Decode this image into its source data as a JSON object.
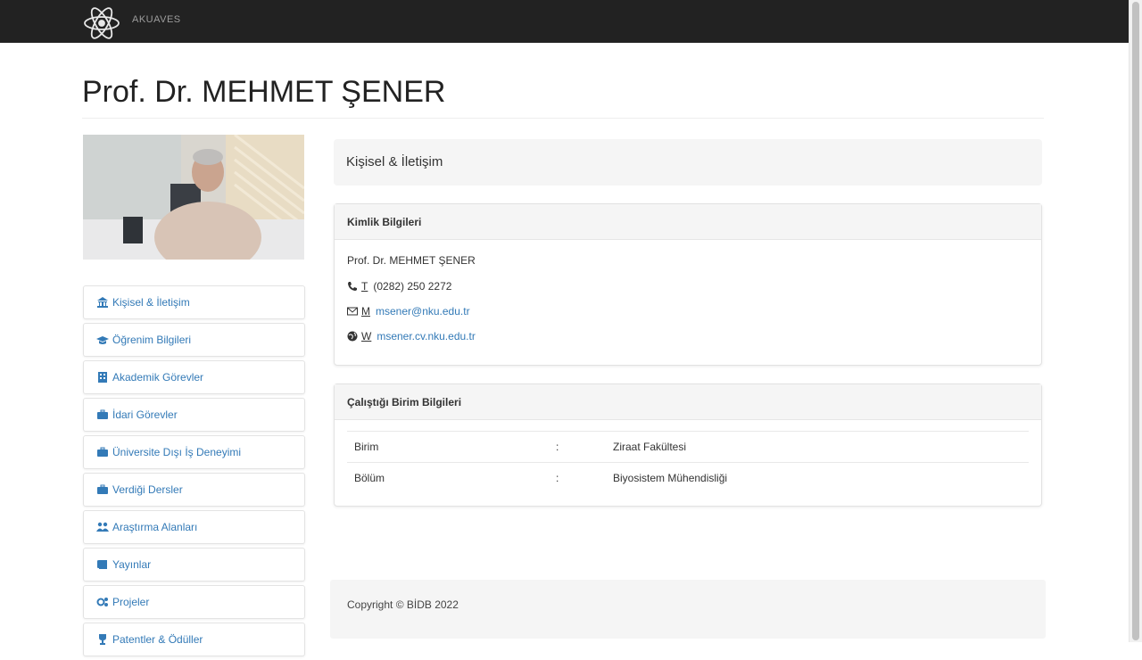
{
  "navbar": {
    "brand": "AKUAVES",
    "logo_icon": "atom-logo-icon",
    "background": "#222222"
  },
  "profile": {
    "name": "Prof. Dr. MEHMET ŞENER"
  },
  "sidebar": {
    "items": [
      {
        "label": "Kişisel & İletişim",
        "icon": "bank-icon"
      },
      {
        "label": "Öğrenim Bilgileri",
        "icon": "graduation-cap-icon"
      },
      {
        "label": "Akademik Görevler",
        "icon": "building-icon"
      },
      {
        "label": "İdari Görevler",
        "icon": "briefcase-icon"
      },
      {
        "label": "Üniversite Dışı İş Deneyimi",
        "icon": "briefcase-icon"
      },
      {
        "label": "Verdiği Dersler",
        "icon": "briefcase-icon"
      },
      {
        "label": "Araştırma Alanları",
        "icon": "users-icon"
      },
      {
        "label": "Yayınlar",
        "icon": "book-icon"
      },
      {
        "label": "Projeler",
        "icon": "gears-icon"
      },
      {
        "label": "Patentler & Ödüller",
        "icon": "trophy-icon"
      }
    ]
  },
  "section": {
    "title": "Kişisel & İletişim"
  },
  "identity": {
    "heading": "Kimlik Bilgileri",
    "name": "Prof. Dr. MEHMET ŞENER",
    "phone_abbr": "T",
    "phone": "(0282) 250 2272",
    "mail_abbr": "M",
    "email": "msener@nku.edu.tr",
    "web_abbr": "W",
    "website": "msener.cv.nku.edu.tr"
  },
  "unit": {
    "heading": "Çalıştığı Birim Bilgileri",
    "rows": [
      {
        "label": "Birim",
        "sep": ":",
        "value": "Ziraat Fakültesi"
      },
      {
        "label": "Bölüm",
        "sep": ":",
        "value": "Biyosistem Mühendisliği"
      }
    ]
  },
  "footer": {
    "copyright": "Copyright © BİDB 2022"
  },
  "colors": {
    "link": "#337ab7",
    "panel_bg": "#f5f5f5"
  }
}
